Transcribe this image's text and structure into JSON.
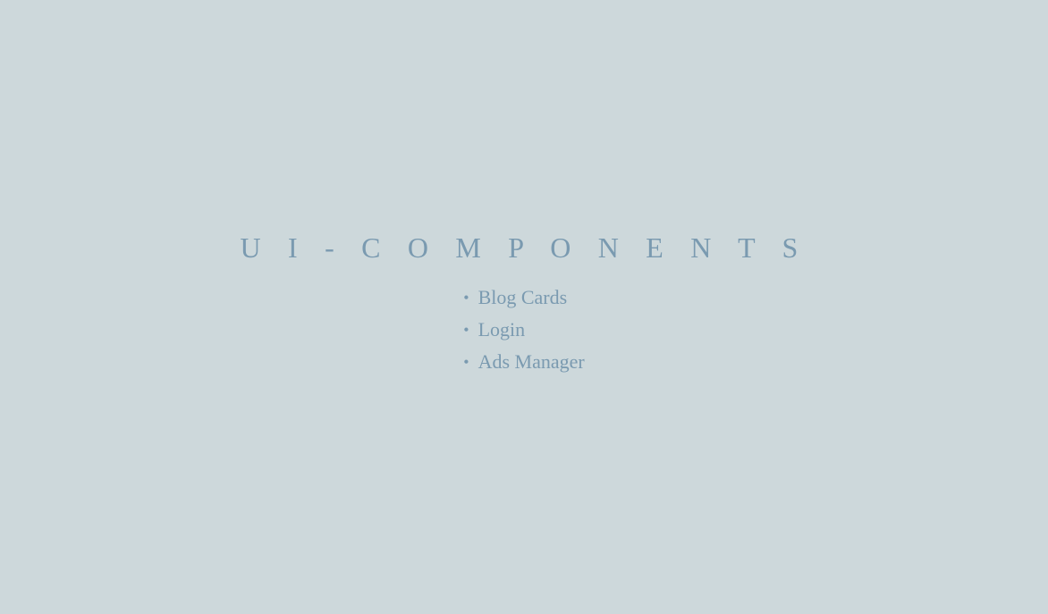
{
  "page": {
    "title": "U I - C O M P O N E N T S",
    "background_color": "#cdd8db",
    "text_color": "#7a9ab0"
  },
  "nav": {
    "items": [
      {
        "id": "blog-cards",
        "label": "Blog Cards"
      },
      {
        "id": "login",
        "label": "Login"
      },
      {
        "id": "ads-manager",
        "label": "Ads Manager"
      }
    ]
  }
}
